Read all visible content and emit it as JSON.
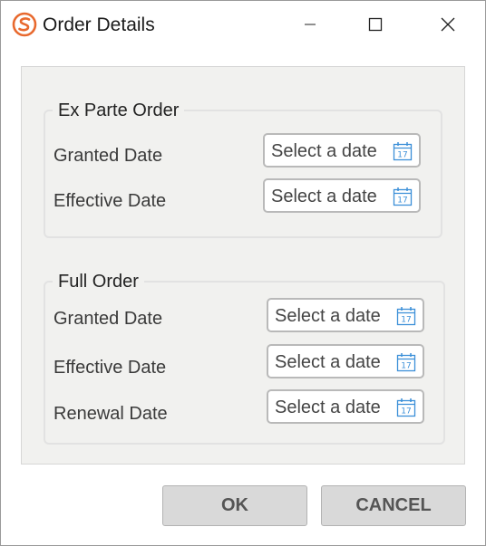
{
  "window": {
    "title": "Order Details",
    "logo_icon": "app-logo-icon",
    "accent_color": "#e8692e"
  },
  "ex_parte": {
    "legend": "Ex Parte Order",
    "rows": [
      {
        "label": "Granted Date",
        "placeholder": "Select a date",
        "icon": "calendar-icon",
        "icon_text": "17"
      },
      {
        "label": "Effective Date",
        "placeholder": "Select a date",
        "icon": "calendar-icon",
        "icon_text": "17"
      }
    ]
  },
  "full_order": {
    "legend": "Full Order",
    "rows": [
      {
        "label": "Granted Date",
        "placeholder": "Select a date",
        "icon": "calendar-icon",
        "icon_text": "17"
      },
      {
        "label": "Effective Date",
        "placeholder": "Select a date",
        "icon": "calendar-icon",
        "icon_text": "17"
      },
      {
        "label": "Renewal Date",
        "placeholder": "Select a date",
        "icon": "calendar-icon",
        "icon_text": "17"
      }
    ]
  },
  "buttons": {
    "ok": "OK",
    "cancel": "CANCEL"
  }
}
